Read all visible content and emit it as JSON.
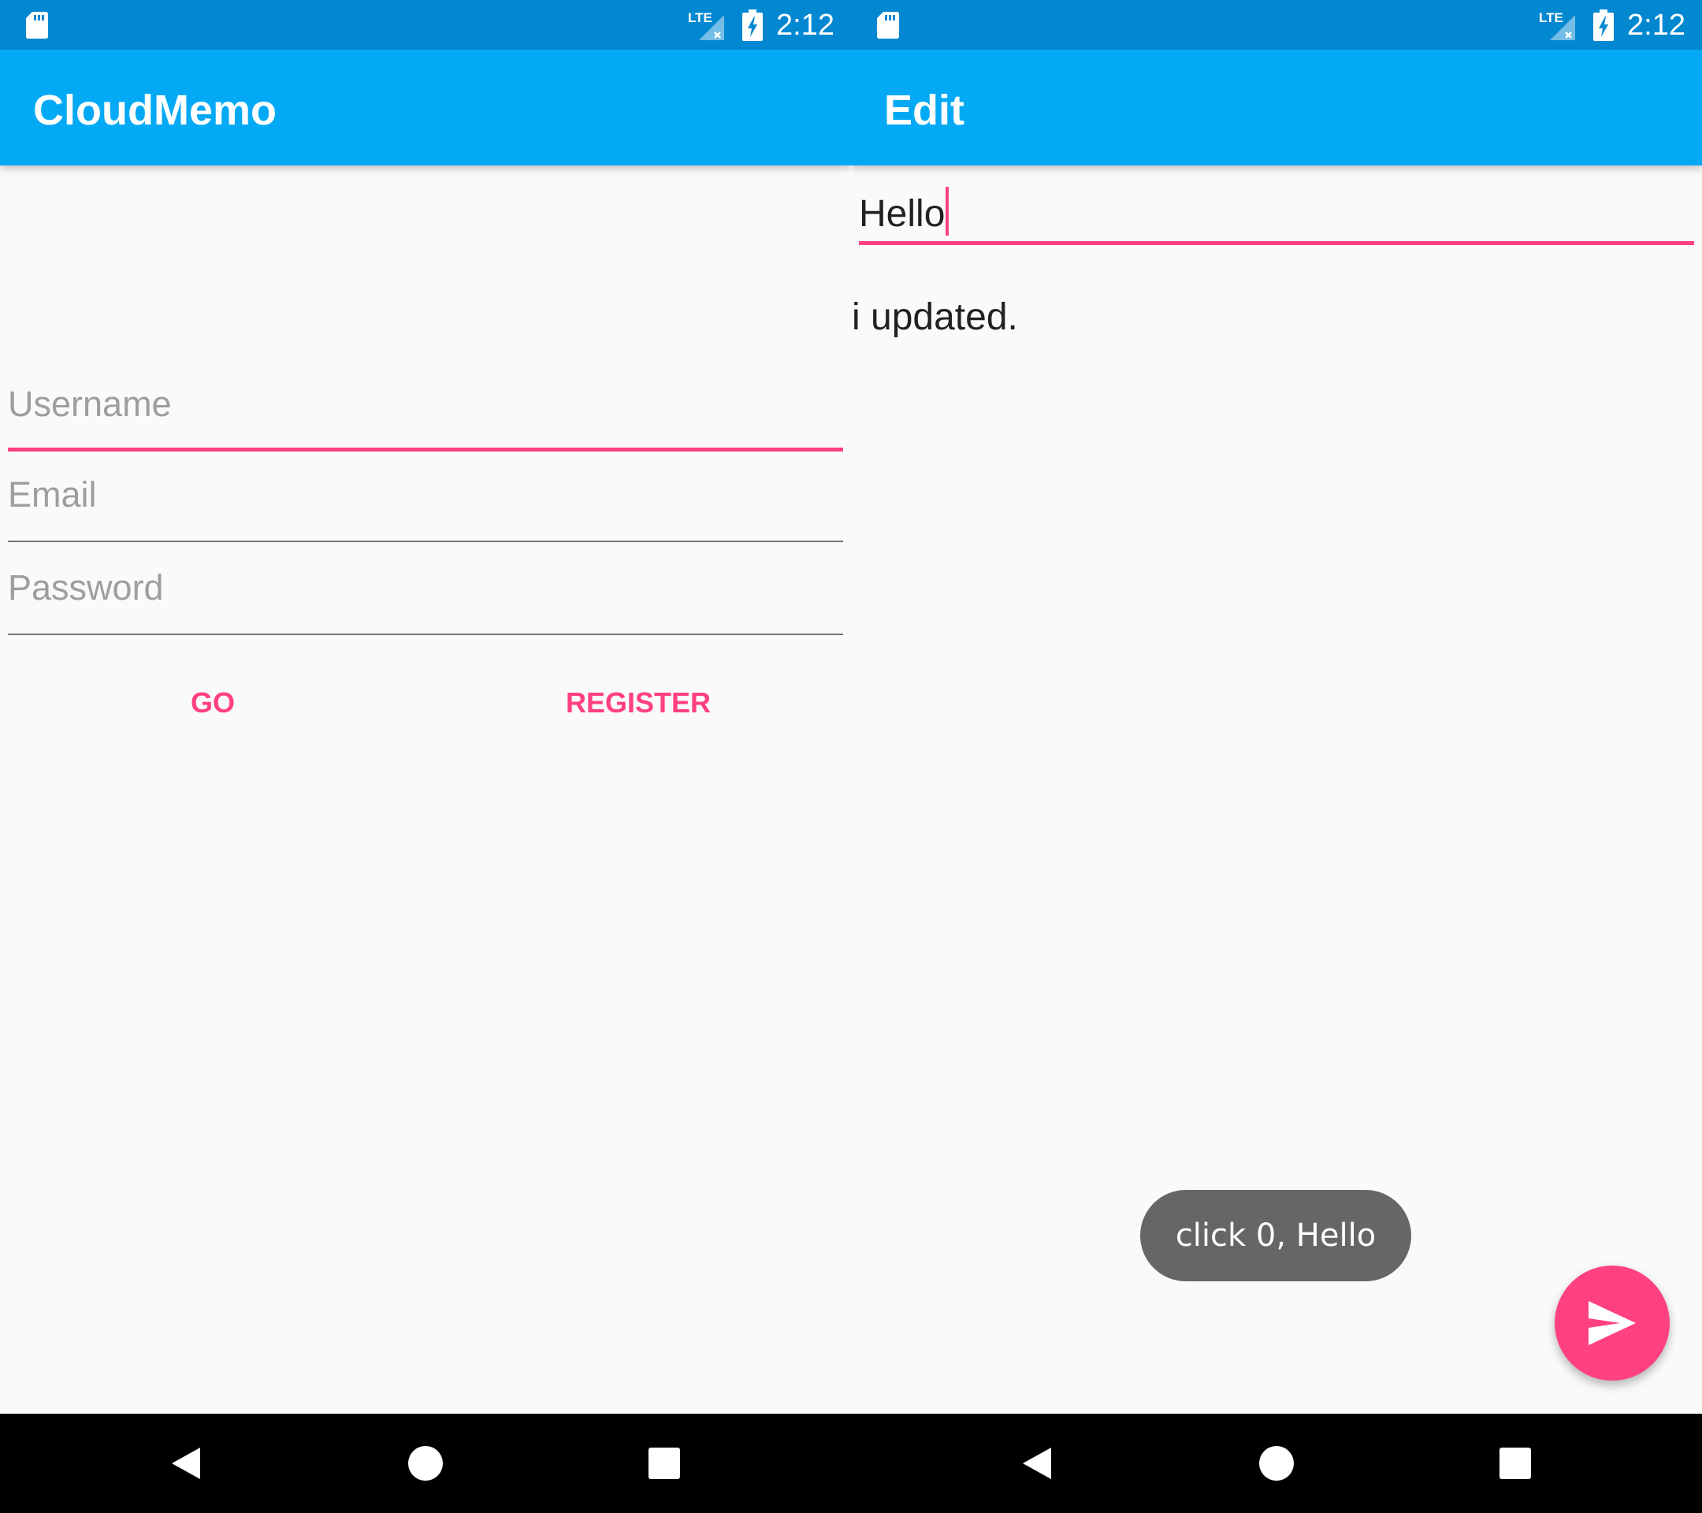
{
  "status_bar": {
    "time": "2:12",
    "network_label": "LTE",
    "icons": [
      "sd-card-icon",
      "lte-signal-icon",
      "battery-charging-icon"
    ]
  },
  "login_screen": {
    "title": "CloudMemo",
    "username_placeholder": "Username",
    "email_placeholder": "Email",
    "password_placeholder": "Password",
    "go_label": "GO",
    "register_label": "REGISTER"
  },
  "edit_screen": {
    "title": "Edit",
    "memo_title_value": "Hello",
    "memo_body": "i updated.",
    "toast_message": "click 0, Hello",
    "fab_icon": "send-icon"
  },
  "nav_bar": {
    "icons": [
      "back-icon",
      "home-icon",
      "recents-icon"
    ]
  },
  "colors": {
    "status_bar": "#0288d1",
    "toolbar": "#03a9f4",
    "accent": "#ff4081",
    "toast": "#666666",
    "background": "#fafafa"
  }
}
